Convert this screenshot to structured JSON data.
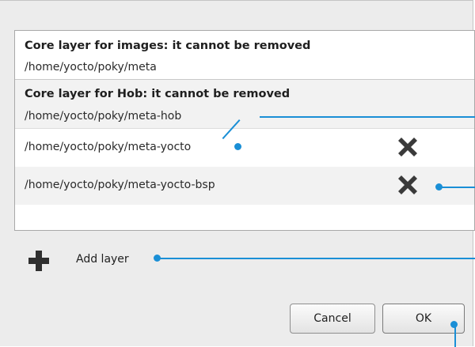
{
  "layers": [
    {
      "title": "Core layer for images: it cannot be removed",
      "path": "/home/yocto/poky/meta"
    },
    {
      "title": "Core layer for Hob: it cannot be removed",
      "path": "/home/yocto/poky/meta-hob"
    },
    {
      "path": "/home/yocto/poky/meta-yocto",
      "removable": true
    },
    {
      "path": "/home/yocto/poky/meta-yocto-bsp",
      "removable": true
    }
  ],
  "add_layer_label": "Add layer",
  "buttons": {
    "cancel": "Cancel",
    "ok": "OK"
  },
  "icons": {
    "remove": "delete-x-icon",
    "add": "plus-icon"
  },
  "colors": {
    "callout": "#1a8fd6",
    "icon": "#3a3a3a"
  }
}
